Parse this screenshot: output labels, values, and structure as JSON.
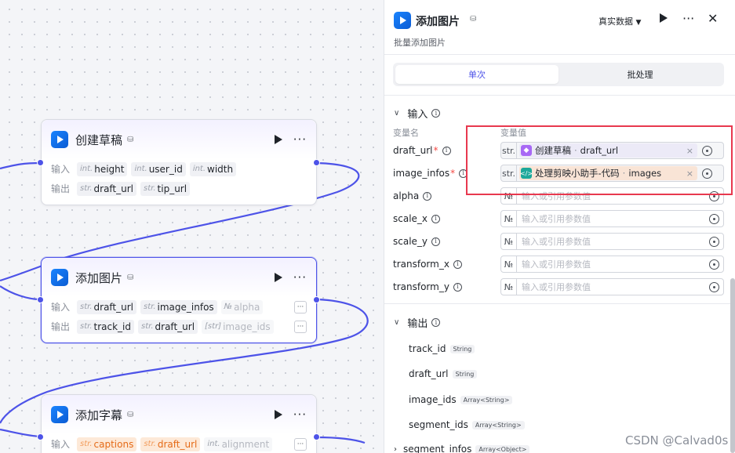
{
  "canvas": {
    "nodes": [
      {
        "title": "创建草稿",
        "input_label": "输入",
        "output_label": "输出",
        "inputs": [
          {
            "type": "int.",
            "name": "height"
          },
          {
            "type": "int.",
            "name": "user_id"
          },
          {
            "type": "int.",
            "name": "width"
          }
        ],
        "outputs": [
          {
            "type": "str.",
            "name": "draft_url"
          },
          {
            "type": "str.",
            "name": "tip_url"
          }
        ]
      },
      {
        "title": "添加图片",
        "input_label": "输入",
        "output_label": "输出",
        "inputs": [
          {
            "type": "str.",
            "name": "draft_url"
          },
          {
            "type": "str.",
            "name": "image_infos"
          },
          {
            "type": "№",
            "name": "alpha"
          }
        ],
        "outputs": [
          {
            "type": "str.",
            "name": "track_id"
          },
          {
            "type": "str.",
            "name": "draft_url"
          },
          {
            "type": "[str]",
            "name": "image_ids"
          }
        ],
        "more_label": "···"
      },
      {
        "title": "添加字幕",
        "input_label": "输入",
        "inputs": [
          {
            "type": "str.",
            "name": "captions"
          },
          {
            "type": "str.",
            "name": "draft_url"
          },
          {
            "type": "int.",
            "name": "alignment"
          }
        ],
        "more_label": "···"
      }
    ]
  },
  "panel": {
    "title": "添加图片",
    "description": "批量添加图片",
    "data_select": "真实数据",
    "tabs": [
      {
        "label": "单次",
        "active": true
      },
      {
        "label": "批处理",
        "active": false
      }
    ],
    "input_section": {
      "title": "输入",
      "col_name": "变量名",
      "col_value": "变量值",
      "params": [
        {
          "name": "draft_url",
          "required": true,
          "type": "str.",
          "ref_node": "创建草稿",
          "ref_field": "draft_url",
          "ref_color": "purple"
        },
        {
          "name": "image_infos",
          "required": true,
          "type": "str.",
          "ref_node": "处理剪映小助手-代码",
          "ref_field": "images",
          "ref_color": "teal"
        },
        {
          "name": "alpha",
          "required": false,
          "type": "№",
          "placeholder": "输入或引用参数值"
        },
        {
          "name": "scale_x",
          "required": false,
          "type": "№",
          "placeholder": "输入或引用参数值"
        },
        {
          "name": "scale_y",
          "required": false,
          "type": "№",
          "placeholder": "输入或引用参数值"
        },
        {
          "name": "transform_x",
          "required": false,
          "type": "№",
          "placeholder": "输入或引用参数值"
        },
        {
          "name": "transform_y",
          "required": false,
          "type": "№",
          "placeholder": "输入或引用参数值"
        }
      ]
    },
    "output_section": {
      "title": "输出",
      "items": [
        {
          "name": "track_id",
          "type": "String"
        },
        {
          "name": "draft_url",
          "type": "String"
        },
        {
          "name": "image_ids",
          "type": "Array<String>"
        },
        {
          "name": "segment_ids",
          "type": "Array<String>"
        },
        {
          "name": "segment_infos",
          "type": "Array<Object>"
        }
      ]
    }
  },
  "watermark": "CSDN @Calvad0s",
  "colors": {
    "accent": "#4d53e8",
    "highlight_box": "#e8384f",
    "purple_chip": "#eceaf7",
    "orange_chip": "#f9e4d6"
  }
}
